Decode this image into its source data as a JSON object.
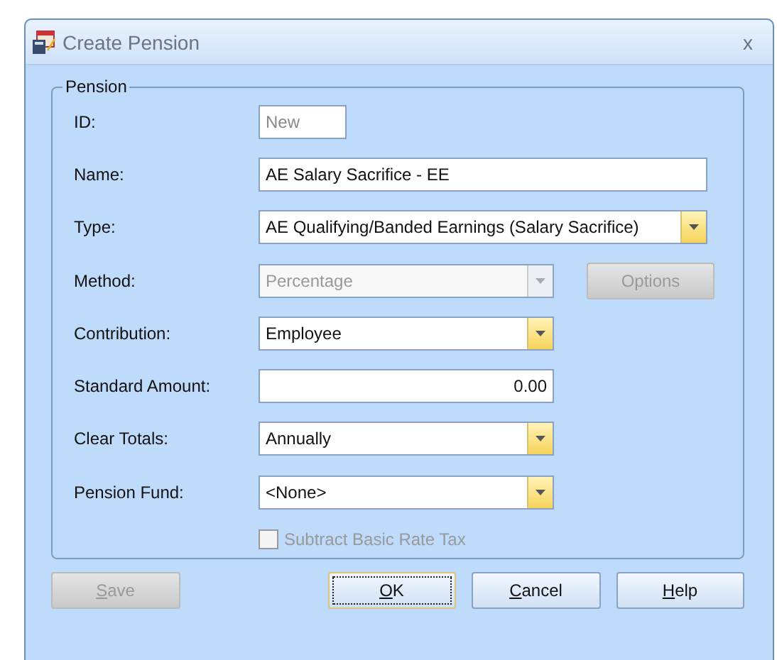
{
  "window": {
    "title": "Create Pension",
    "close": "x"
  },
  "group": {
    "title": "Pension",
    "fields": [
      {
        "kind": "text",
        "label": "ID:",
        "value": "New",
        "narrow": true,
        "disabled": true
      },
      {
        "kind": "text",
        "label": "Name:",
        "value": "AE Salary Sacrifice - EE",
        "wide": true,
        "disabled": false
      },
      {
        "kind": "combo",
        "label": "Type:",
        "value": "AE Qualifying/Banded Earnings (Salary Sacrifice)",
        "wide": true,
        "disabled": false
      },
      {
        "kind": "combo",
        "label": "Method:",
        "value": "Percentage",
        "disabled": true,
        "side_button": {
          "label": "Options",
          "disabled": true
        }
      },
      {
        "kind": "combo",
        "label": "Contribution:",
        "value": "Employee",
        "disabled": false
      },
      {
        "kind": "number",
        "label": "Standard Amount:",
        "value": "0.00",
        "disabled": false
      },
      {
        "kind": "combo",
        "label": "Clear Totals:",
        "value": "Annually",
        "disabled": false
      },
      {
        "kind": "combo",
        "label": "Pension Fund:",
        "value": "<None>",
        "disabled": false
      },
      {
        "kind": "checkbox",
        "label": "Subtract Basic Rate Tax",
        "checked": false,
        "disabled": true
      }
    ]
  },
  "buttons": [
    {
      "label": "Save",
      "disabled": true,
      "focused": false,
      "mnemonic_first": true
    },
    {
      "label": "OK",
      "disabled": false,
      "focused": true,
      "mnemonic_first": true
    },
    {
      "label": "Cancel",
      "disabled": false,
      "focused": false,
      "mnemonic_first": true
    },
    {
      "label": "Help",
      "disabled": false,
      "focused": false,
      "mnemonic_first": true
    }
  ]
}
